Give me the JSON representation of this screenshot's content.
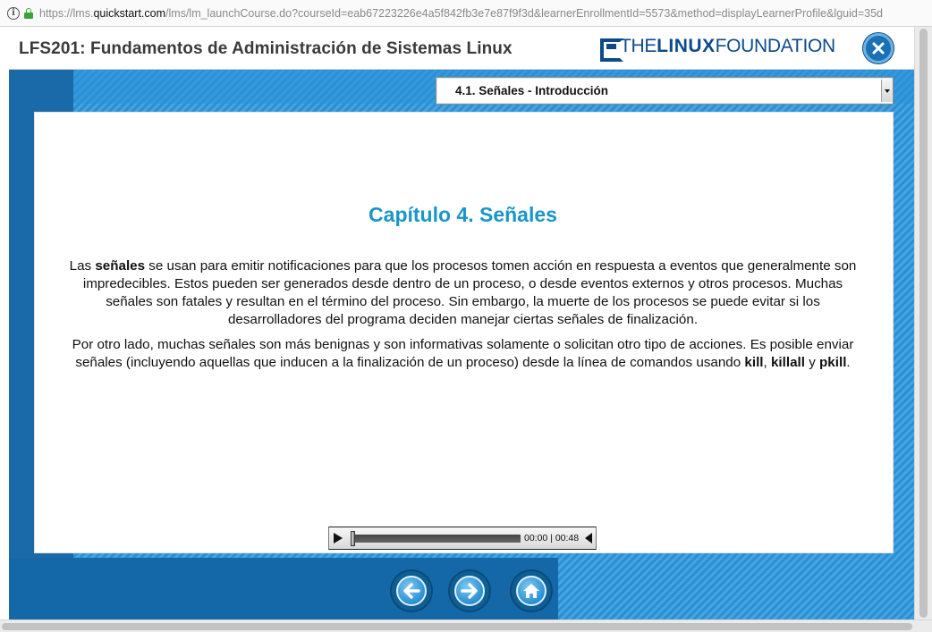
{
  "browser": {
    "url_prefix": "https://lms.",
    "url_domain": "quickstart.com",
    "url_rest": "/lms/lm_launchCourse.do?courseId=eab67223226e4a5f842fb3e7e87f9f3d&learnerEnrollmentId=5573&method=displayLearnerProfile&lguid=35d",
    "info_icon": "i"
  },
  "header": {
    "course_title": "LFS201: Fundamentos de Administración de Sistemas Linux",
    "brand_the": "THE",
    "brand_linux": "LINUX",
    "brand_foundation": "FOUNDATION",
    "close_icon": "close-icon"
  },
  "section_select": {
    "selected": "4.1. Señales - Introducción"
  },
  "content": {
    "chapter_title": "Capítulo 4. Señales",
    "p1_a": "Las ",
    "p1_bold": "señales",
    "p1_b": " se usan para emitir notificaciones para que los procesos tomen acción en respuesta a eventos que generalmente son impredecibles. Estos pueden ser generados desde dentro de un proceso, o desde eventos externos y otros procesos. Muchas señales son fatales y resultan en el término del proceso. Sin embargo, la muerte de los procesos se puede evitar si los desarrolladores del programa deciden manejar ciertas señales de finalización.",
    "p2_a": "Por otro lado, muchas señales son más benignas y son informativas solamente o solicitan otro tipo de acciones. Es posible enviar señales (incluyendo aquellas que inducen a la finalización de un proceso) desde la línea de comandos usando ",
    "p2_kill": "kill",
    "p2_b": ", ",
    "p2_killall": "killall",
    "p2_c": " y ",
    "p2_pkill": "pkill",
    "p2_d": "."
  },
  "player": {
    "time": "00:00 | 00:48",
    "progress": 0
  },
  "nav": {
    "back_icon": "arrow-left-icon",
    "forward_icon": "arrow-right-icon",
    "home_icon": "home-icon"
  },
  "colors": {
    "brand_blue": "#0d4a8c",
    "title_blue": "#1996c9",
    "frame_blue": "#1c6fb0"
  }
}
